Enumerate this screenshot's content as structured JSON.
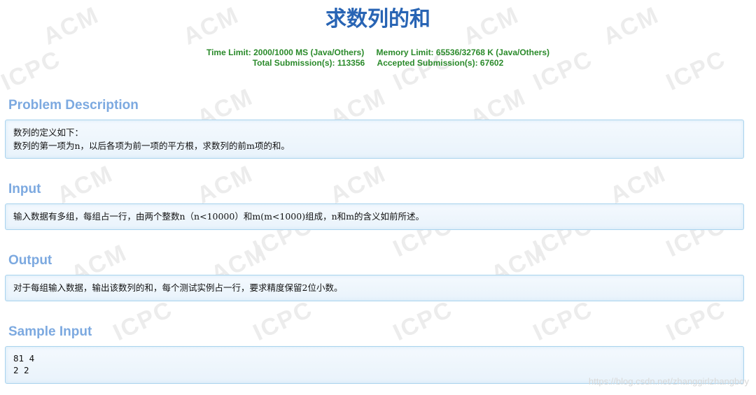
{
  "problem": {
    "title": "求数列的和",
    "time_limit": "Time Limit: 2000/1000 MS (Java/Others)",
    "memory_limit": "Memory Limit: 65536/32768 K (Java/Others)",
    "total_submissions": "Total Submission(s): 113356",
    "accepted_submissions": "Accepted Submission(s): 67602"
  },
  "sections": {
    "description": {
      "heading": "Problem Description",
      "lines": [
        "数列的定义如下：",
        "数列的第一项为n，以后各项为前一项的平方根，求数列的前m项的和。"
      ]
    },
    "input": {
      "heading": "Input",
      "lines": [
        "输入数据有多组，每组占一行，由两个整数n（n<10000）和m(m<1000)组成，n和m的含义如前所述。"
      ]
    },
    "output": {
      "heading": "Output",
      "lines": [
        "对于每组输入数据，输出该数列的和，每个测试实例占一行，要求精度保留2位小数。"
      ]
    },
    "sample_input": {
      "heading": "Sample Input",
      "lines": [
        "81 4",
        "2 2"
      ]
    }
  },
  "watermark": {
    "acm": "ACM",
    "icpc": "ICPC",
    "credit": "https://blog.csdn.net/zhanggirlzhangboy"
  },
  "colors": {
    "title": "#2864b4",
    "meta": "#2a8a2a",
    "section_heading": "#7ca9e0",
    "panel_border": "#a9d3ee"
  }
}
